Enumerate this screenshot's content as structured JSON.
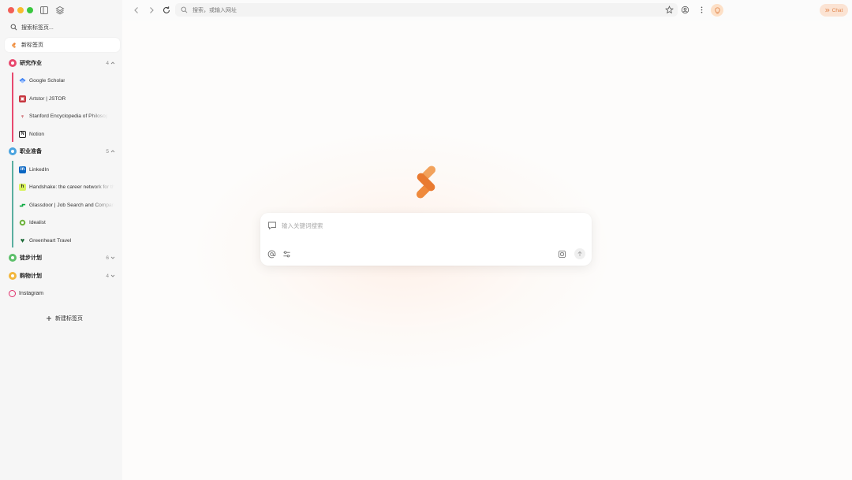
{
  "sidebar": {
    "search_label": "搜索标签页...",
    "new_tab_label": "新标签页",
    "groups": [
      {
        "label": "研究作业",
        "count": "4",
        "color": "#e8496e",
        "tabs": [
          {
            "label": "Google Scholar"
          },
          {
            "label": "Artstor | JSTOR"
          },
          {
            "label": "Stanford Encyclopedia of Philosophy"
          },
          {
            "label": "Notion"
          }
        ]
      },
      {
        "label": "职业准备",
        "count": "5",
        "color": "#4aa3df",
        "tabs": [
          {
            "label": "LinkedIn"
          },
          {
            "label": "Handshake: the career network for the next generation"
          },
          {
            "label": "Glassdoor | Job Search and Company Reviews"
          },
          {
            "label": "Idealist"
          },
          {
            "label": "Greenheart Travel"
          }
        ]
      },
      {
        "label": "徒步计划",
        "count": "6",
        "color": "#5cbf6a"
      },
      {
        "label": "购物计划",
        "count": "4",
        "color": "#f2b63c"
      }
    ],
    "pinned": [
      {
        "label": "Instagram"
      }
    ],
    "add_new_tab_label": "新建标签页"
  },
  "toolbar": {
    "url_placeholder": "搜索，或输入网址",
    "chat_label": "Chat"
  },
  "main": {
    "search_placeholder": "输入关键词搜索"
  },
  "colors": {
    "accent": "#ef8a3c",
    "chat_bg": "#fbe3d3"
  }
}
